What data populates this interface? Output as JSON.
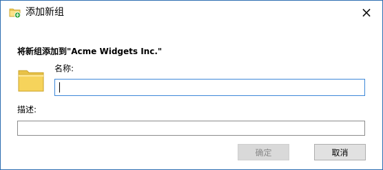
{
  "window": {
    "title": "添加新组",
    "close_symbol": "×",
    "title_icon": "add-group-folder-icon"
  },
  "form": {
    "heading": "将新组添加到\"Acme Widgets Inc.\"",
    "folder_icon": "folder-icon",
    "name_label": "名称:",
    "name_value": "",
    "description_label": "描述:",
    "description_value": ""
  },
  "buttons": {
    "ok_label": "确定",
    "ok_enabled": false,
    "cancel_label": "取消"
  },
  "colors": {
    "window_border": "#2b6cb0",
    "focused_input_border": "#3a86d8",
    "folder_yellow": "#f6d35b",
    "title_icon_green": "#3aa845",
    "disabled_text": "#8a8a8a"
  }
}
